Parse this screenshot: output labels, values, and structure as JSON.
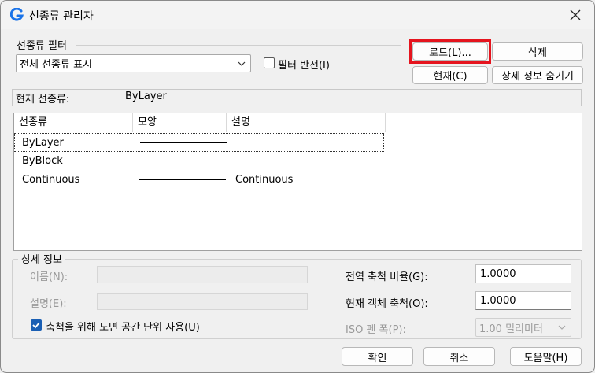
{
  "window": {
    "title": "선종류 관리자",
    "close_icon": "close-icon",
    "app_icon": "app-g-icon",
    "accent": "#1a73e8"
  },
  "filter": {
    "group_label": "선종류 필터",
    "selected": "전체 선종류 표시",
    "invert_label": "필터 반전(I)",
    "invert_checked": false
  },
  "buttons": {
    "load": "로드(L)...",
    "delete": "삭제",
    "current": "현재(C)",
    "hide_details": "상세 정보 숨기기"
  },
  "current": {
    "label": "현재 선종류:",
    "value": "ByLayer"
  },
  "list": {
    "columns": [
      "선종류",
      "모양",
      "설명"
    ],
    "rows": [
      {
        "name": "ByLayer",
        "description": "",
        "selected": true
      },
      {
        "name": "ByBlock",
        "description": "",
        "selected": false
      },
      {
        "name": "Continuous",
        "description": "Continuous",
        "selected": false
      }
    ]
  },
  "details": {
    "group_label": "상세 정보",
    "name_label": "이름(N):",
    "name_value": "",
    "desc_label": "설명(E):",
    "desc_value": "",
    "paper_space_label": "축척을 위해 도면 공간 단위 사용(U)",
    "paper_space_checked": true,
    "global_scale_label": "전역 축척 비율(G):",
    "global_scale_value": "1.0000",
    "current_scale_label": "현재 객체 축척(O):",
    "current_scale_value": "1.0000",
    "iso_pen_label": "ISO 펜 폭(P):",
    "iso_pen_value": "1.00 밀리미터"
  },
  "footer": {
    "ok": "확인",
    "cancel": "취소",
    "help": "도움말(H)"
  },
  "colors": {
    "highlight": "#e5141e",
    "checkbox": "#1a5fb4"
  }
}
